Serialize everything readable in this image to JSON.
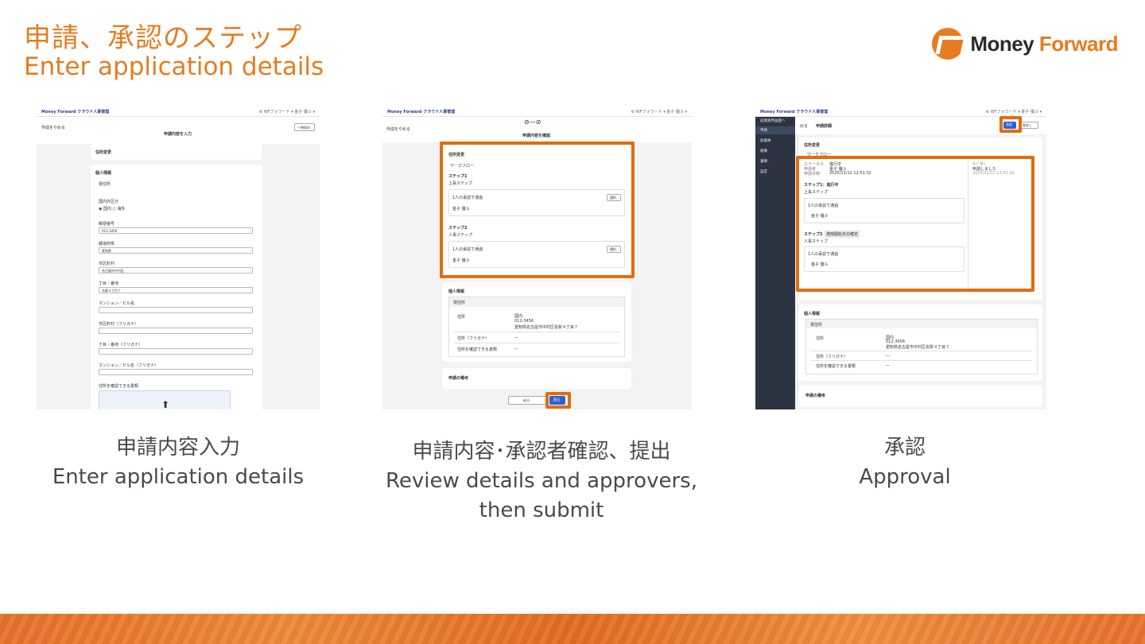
{
  "header": {
    "title_jp": "申請、承認のステップ",
    "title_en": "Enter application details"
  },
  "logo": {
    "word1": "Money",
    "word2": "Forward",
    "icon": "money-forward-logo-icon"
  },
  "steps": [
    {
      "caption_jp": "申請内容入力",
      "caption_en": "Enter application details",
      "screen": {
        "brand": "Money Forward クラウド人事管理",
        "back_link": "作成をやめる",
        "step_title": "申請内容を入力",
        "save_button": "一時保存",
        "section_title": "住所変更",
        "personal_info": "個人情報",
        "current_address": "現住所",
        "domestic_label": "国内外区分",
        "domestic": "国内",
        "overseas": "海外",
        "postal_label": "郵便番号",
        "postal_value": "012-3456",
        "prefecture_label": "都道府県",
        "prefecture_value": "愛知県",
        "city_label": "市区町村",
        "city_value": "名古屋市中村区",
        "street_label": "丁目・番地",
        "street_value": "名駅４丁目７",
        "building_label": "マンション／ビル名",
        "city_kana_label": "市区町村（フリガナ）",
        "street_kana_label": "丁目・番地（フリガナ）",
        "building_kana_label": "マンション／ビル名（フリガナ）",
        "document_label": "住所を確認できる書類"
      }
    },
    {
      "caption_jp": "申請内容･承認者確認、提出",
      "caption_en": "Review details and approvers, then submit",
      "screen": {
        "brand": "Money Forward クラウド人事管理",
        "back_link": "作成をやめる",
        "step_title": "申請内容を確認",
        "section_title": "住所変更",
        "workflow": "ワークフロー",
        "step1": "ステップ1",
        "step1_name": "上長ステップ",
        "approval_rule": "1人の承認で通過",
        "approver": "金子 優斗",
        "select_button": "選択",
        "step2": "ステップ2",
        "step2_name": "人事ステップ",
        "personal_info": "個人情報",
        "current_address": "現住所",
        "address_label": "住所",
        "address_value_1": "国内",
        "address_value_2": "012-3456",
        "address_value_3": "愛知県名古屋市中村区名駅４丁目７",
        "kana_label": "住所（フリガナ）",
        "document_label": "住所を確認できる書類",
        "dash": "—",
        "remarks": "申請の備考",
        "back_button": "戻る",
        "submit_button": "提出"
      }
    },
    {
      "caption_jp": "承認",
      "caption_en": "Approval",
      "screen": {
        "brand": "Money Forward クラウド人事管理",
        "nav": [
          "従業員用画面へ",
          "申請",
          "従業員",
          "組織",
          "書類",
          "設定"
        ],
        "back_link": "戻る",
        "page_title": "申請詳細",
        "approve_button": "承認",
        "reject_button": "差戻し",
        "section_title": "住所変更",
        "workflow": "ワークフロー",
        "status_label": "ステータス",
        "status_value": "進行中",
        "applicant_label": "申請者",
        "applicant_value": "金子 優斗",
        "date_label": "申請日時",
        "date_value": "2025/11/12 12:51:32",
        "history_name": "金子 優斗",
        "history_action": "申請しました",
        "history_date": "2025/11/12 12:51:32",
        "step1_status": "ステップ1：進行中",
        "step1_name": "上長ステップ",
        "approval_rule": "1人の承認で通過",
        "approver": "金子 優斗",
        "step2": "ステップ2",
        "step2_badge": "適用開始日の確定",
        "step2_name": "人事ステップ",
        "personal_info": "個人情報",
        "current_address": "現住所",
        "address_label": "住所",
        "address_value_1": "国内",
        "address_value_2": "012-3456",
        "address_value_3": "愛知県名古屋市中村区名駅４丁目７",
        "kana_label": "住所（フリガナ）",
        "document_label": "住所を確認できる書類",
        "dash": "—",
        "remarks": "申請の備考"
      }
    }
  ],
  "colors": {
    "accent": "#e57c1f",
    "highlight": "#e36c0a",
    "primary_button": "#2f62d0",
    "caption_text": "#4a4a4a"
  }
}
